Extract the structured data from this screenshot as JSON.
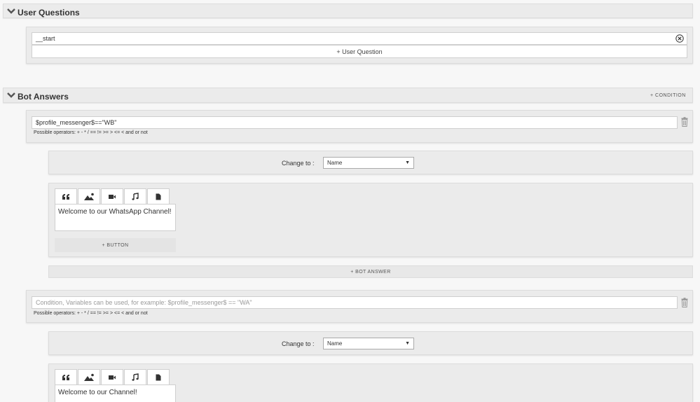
{
  "user_questions": {
    "title": "User Questions",
    "question_value": "__start",
    "add_label": "+ User Question"
  },
  "bot_answers": {
    "title": "Bot Answers",
    "add_condition_label": "+ CONDITION",
    "conditions": [
      {
        "value": "$profile_messenger$==\"WB\"",
        "placeholder": "",
        "operators_hint": "Possible operators: + - * / == != >= > <= < and or not",
        "change_to_label": "Change to :",
        "change_to_value": "Name",
        "message_text": "Welcome to our WhatsApp Channel!",
        "add_button_label": "+ BUTTON",
        "add_bot_answer_label": "+ BOT ANSWER"
      },
      {
        "value": "",
        "placeholder": "Condition, Variables can be used, for example: $profile_messenger$ == \"WA\"",
        "operators_hint": "Possible operators: + - * / == != >= > <= < and or not",
        "change_to_label": "Change to :",
        "change_to_value": "Name",
        "message_text": "Welcome to our Channel!"
      }
    ]
  },
  "tab_icons": [
    "quote-icon",
    "image-icon",
    "video-icon",
    "music-icon",
    "file-icon"
  ]
}
